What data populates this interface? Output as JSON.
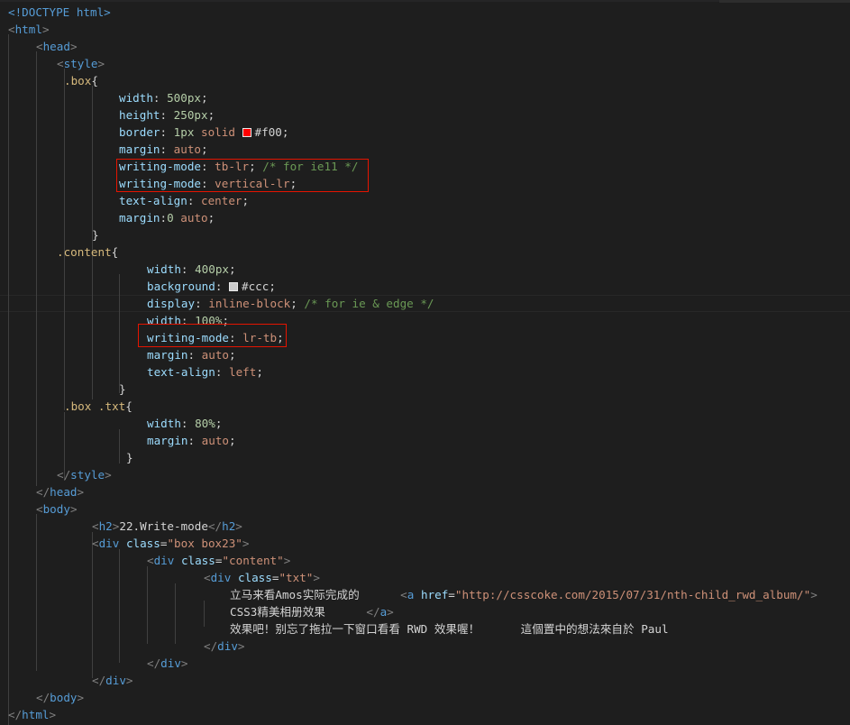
{
  "colors": {
    "background": "#1e1e1e",
    "tag": "#569cd6",
    "attribute": "#9cdcfe",
    "string": "#ce9178",
    "text": "#d4d4d4",
    "comment": "#6a9955",
    "number": "#b5cea8",
    "selector": "#d7ba7d",
    "punct": "#808080",
    "highlight_box": "#e51400"
  },
  "swatches": {
    "red": "#ff0000",
    "grey": "#cccccc"
  },
  "code_lines": [
    [
      "<!DOCTYPE html>"
    ],
    [
      "<",
      "html",
      ">"
    ],
    [
      "<",
      "head",
      ">"
    ],
    [
      "<",
      "style",
      ">"
    ],
    [
      ".box",
      "{"
    ],
    [
      "width",
      ": ",
      "500px",
      ";"
    ],
    [
      "height",
      ": ",
      "250px",
      ";"
    ],
    [
      "border",
      ": ",
      "1px",
      " ",
      "solid",
      " ",
      "",
      "#f00",
      ";"
    ],
    [
      "margin",
      ": ",
      "auto",
      ";"
    ],
    [
      "writing-mode",
      ": ",
      "tb-lr",
      "; ",
      "/* for ie11 */"
    ],
    [
      "writing-mode",
      ": ",
      "vertical-lr",
      ";"
    ],
    [
      "text-align",
      ": ",
      "center",
      ";"
    ],
    [
      "margin",
      ":",
      "0",
      " ",
      "auto",
      ";"
    ],
    [
      "}"
    ],
    [
      ".content",
      "{"
    ],
    [
      "width",
      ": ",
      "400px",
      ";"
    ],
    [
      "background",
      ": ",
      "",
      "#ccc",
      ";"
    ],
    [
      "display",
      ": ",
      "inline-block",
      "; ",
      "/* for ie & edge */"
    ],
    [
      "width",
      ": ",
      "100%",
      ";"
    ],
    [
      "writing-mode",
      ": ",
      "lr-tb",
      ";"
    ],
    [
      "margin",
      ": ",
      "auto",
      ";"
    ],
    [
      "text-align",
      ": ",
      "left",
      ";"
    ],
    [
      "}"
    ],
    [
      ".box .txt",
      "{"
    ],
    [
      "width",
      ": ",
      "80%",
      ";"
    ],
    [
      "margin",
      ": ",
      "auto",
      ";"
    ],
    [
      "}"
    ],
    [
      "</",
      "style",
      ">"
    ],
    [
      "</",
      "head",
      ">"
    ],
    [
      "<",
      "body",
      ">"
    ],
    [
      "<",
      "h2",
      ">",
      "22.Write-mode",
      "</",
      "h2",
      ">"
    ],
    [
      "<",
      "div",
      " ",
      "class",
      "=",
      "\"box box23\"",
      ">"
    ],
    [
      "<",
      "div",
      " ",
      "class",
      "=",
      "\"content\"",
      ">"
    ],
    [
      "<",
      "div",
      " ",
      "class",
      "=",
      "\"txt\"",
      ">"
    ],
    [
      "立马来看Amos实际完成的      ",
      "<",
      "a",
      " ",
      "href",
      "=",
      "\"",
      "http://csscoke.com/2015/07/31/nth-child_rwd_album/",
      "\"",
      ">"
    ],
    [
      "CSS3精美相册效果      ",
      "</",
      "a",
      ">"
    ],
    [
      "效果吧！别忘了拖拉一下窗口看看 RWD 效果喔！      這個置中的想法來自於 Paul"
    ],
    [
      "</",
      "div",
      ">"
    ],
    [
      "</",
      "div",
      ">"
    ],
    [
      "</",
      "div",
      ">"
    ],
    [
      "</",
      "body",
      ">"
    ],
    [
      "</",
      "html",
      ">"
    ]
  ]
}
